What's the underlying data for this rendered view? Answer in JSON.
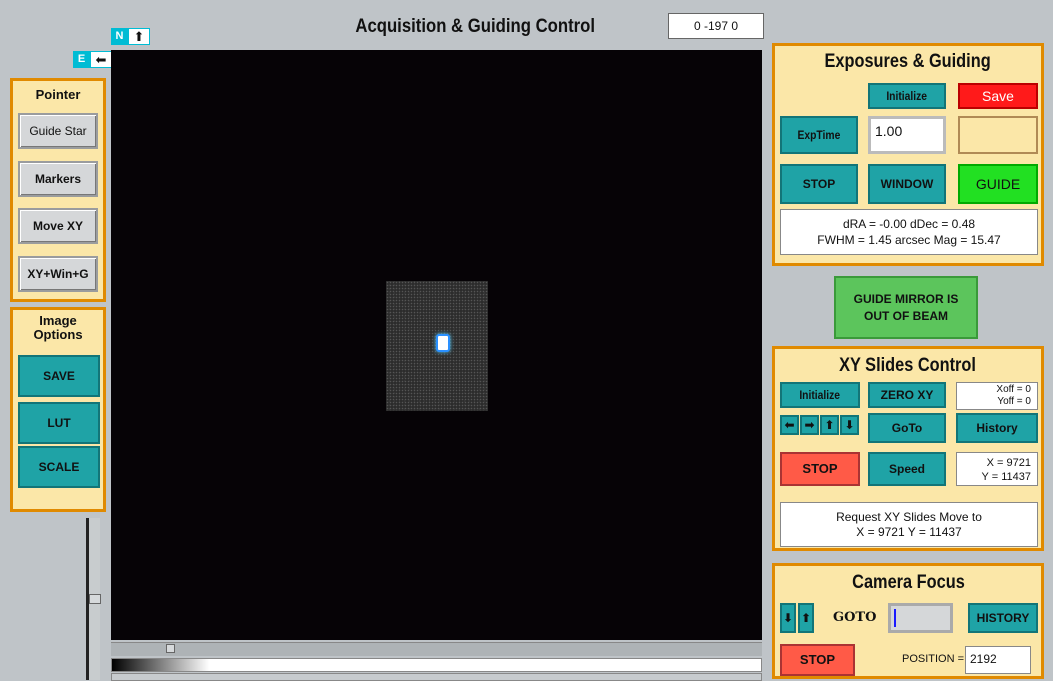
{
  "window": {
    "title": "Acquisition & Guiding Control",
    "readout": "0 -197 0"
  },
  "compass": {
    "north": "N",
    "east": "E"
  },
  "pointer": {
    "header": "Pointer",
    "buttons": [
      "Guide Star",
      "Markers",
      "Move XY",
      "XY+Win+G"
    ]
  },
  "image_options": {
    "header": "Image\nOptions",
    "buttons": [
      "SAVE",
      "LUT",
      "SCALE"
    ]
  },
  "exposures": {
    "header": "Exposures & Guiding",
    "initialize": "Initialize",
    "save": "Save",
    "exptime_label": "ExpTime",
    "exptime_value": "1.00",
    "stop": "STOP",
    "window": "WINDOW",
    "guide": "GUIDE",
    "status_line1": "dRA = -0.00  dDec = 0.48",
    "status_line2": "FWHM = 1.45 arcsec    Mag = 15.47"
  },
  "guide_mirror": {
    "line1": "GUIDE MIRROR IS",
    "line2": "OUT OF BEAM"
  },
  "xy_slides": {
    "header": "XY Slides Control",
    "initialize": "Initialize",
    "zero": "ZERO XY",
    "xoff": "Xoff = 0",
    "yoff": "Yoff = 0",
    "goto": "GoTo",
    "history": "History",
    "stop": "STOP",
    "speed": "Speed",
    "x_pos": "X = 9721",
    "y_pos": "Y = 11437",
    "request_line1": "Request XY Slides Move to",
    "request_line2": "X = 9721   Y = 11437"
  },
  "camera_focus": {
    "header": "Camera Focus",
    "goto": "GOTO",
    "history": "HISTORY",
    "stop": "STOP",
    "position_label": "POSITION =",
    "position_value": "2192"
  },
  "colors": {
    "panel_bg": "#fbe7a8",
    "panel_border": "#e08a00",
    "teal": "#1fa3a6",
    "red": "#ff1a1a",
    "green": "#22e022",
    "mirror_green": "#5cc55c"
  }
}
